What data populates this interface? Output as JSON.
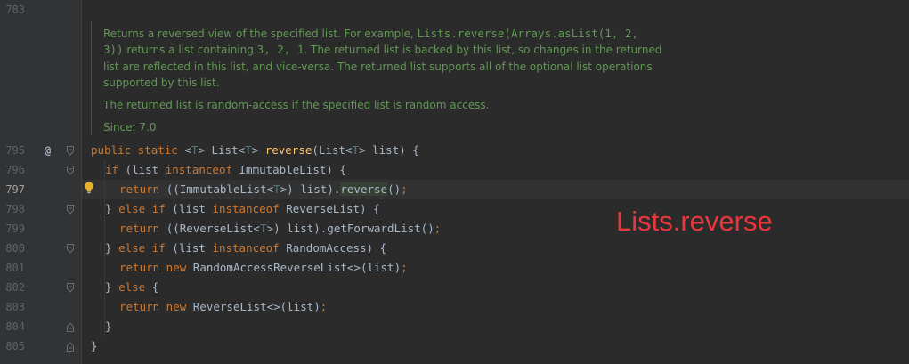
{
  "gutter": {
    "line_numbers": [
      "783",
      "795",
      "796",
      "797",
      "798",
      "799",
      "800",
      "801",
      "802",
      "803",
      "804",
      "805"
    ],
    "current_line": "797",
    "annotation_marker": "@"
  },
  "javadoc": {
    "para1_a": "Returns a reversed view of the specified list. For example, ",
    "para1_code1": "Lists.reverse(Arrays.asList(1, 2,",
    "para1_code2": "3))",
    "para1_b": " returns a list containing ",
    "para1_code3": "3, 2, 1",
    "para1_c": ". The returned list is backed by this list, so changes in the returned list are reflected in this list, and vice-versa. The returned list supports all of the optional list operations supported by this list.",
    "para2": "The returned list is random-access if the specified list is random access.",
    "since": "Since: 7.0"
  },
  "code": {
    "l795": {
      "a": "public static ",
      "b": "<",
      "c": "T",
      "d": "> List<",
      "e": "T",
      "f": "> ",
      "g": "reverse",
      "h": "(List<",
      "i": "T",
      "j": "> list) {"
    },
    "l796": {
      "a": "if ",
      "b": "(list ",
      "c": "instanceof ",
      "d": "ImmutableList) {"
    },
    "l797": {
      "a": "return ",
      "b": "((ImmutableList<",
      "c": "T",
      "d": ">) list).",
      "e": "reverse",
      "f": "()",
      "g": ";"
    },
    "l798": {
      "a": "} ",
      "b": "else if ",
      "c": "(list ",
      "d": "instanceof ",
      "e": "ReverseList) {"
    },
    "l799": {
      "a": "return ",
      "b": "((ReverseList<",
      "c": "T",
      "d": ">) list).getForwardList()",
      "e": ";"
    },
    "l800": {
      "a": "} ",
      "b": "else if ",
      "c": "(list ",
      "d": "instanceof ",
      "e": "RandomAccess) {"
    },
    "l801": {
      "a": "return new ",
      "b": "RandomAccessReverseList<>(list)",
      "c": ";"
    },
    "l802": {
      "a": "} ",
      "b": "else ",
      "c": "{"
    },
    "l803": {
      "a": "return new ",
      "b": "ReverseList<>(list)",
      "c": ";"
    },
    "l804": "}",
    "l805": "}"
  },
  "overlay_label": "Lists.reverse",
  "colors": {
    "keyword": "#cc7832",
    "method": "#ffc66d",
    "type_param": "#507874",
    "doc": "#629755",
    "overlay": "#e8383d"
  }
}
